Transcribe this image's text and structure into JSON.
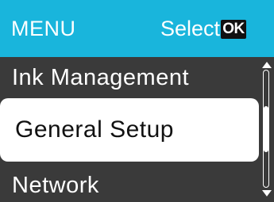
{
  "header": {
    "title": "MENU",
    "select_label": "Select",
    "ok_badge": "OK"
  },
  "menu": {
    "items": [
      {
        "label": "Ink Management",
        "selected": false
      },
      {
        "label": "General Setup",
        "selected": true
      },
      {
        "label": "Network",
        "selected": false
      }
    ]
  },
  "scrollbar": {
    "position_fraction": 0.5
  },
  "colors": {
    "header_bg": "#19b5dc",
    "body_bg": "#3a3a3a",
    "highlight_bg": "#ffffff",
    "text_light": "#ffffff",
    "text_dark": "#111111"
  },
  "icons": {
    "scroll_up": "triangle-up-icon",
    "scroll_down": "triangle-down-icon"
  }
}
